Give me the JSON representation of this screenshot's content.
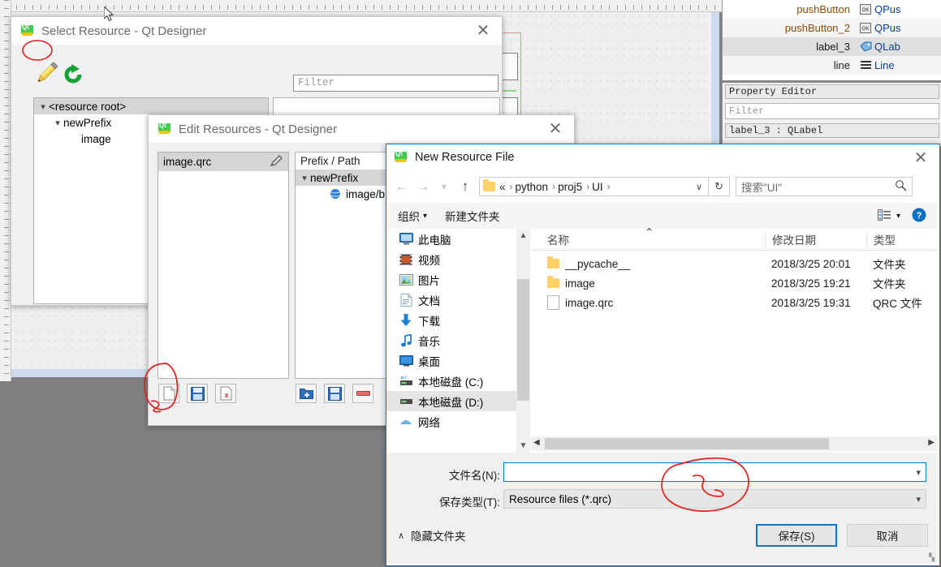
{
  "designer": {
    "object_inspector": {
      "rows": [
        {
          "name": "pushButton",
          "class": "QPus",
          "icon": "ok-button-icon"
        },
        {
          "name": "pushButton_2",
          "class": "QPus",
          "icon": "ok-button-icon"
        },
        {
          "name": "label_3",
          "class": "QLab",
          "icon": "label-tag-icon"
        },
        {
          "name": "line",
          "class": "Line",
          "icon": "line-icon"
        }
      ]
    },
    "property_editor": {
      "title": "Property Editor",
      "filter_placeholder": "Filter",
      "selected_object": "label_3 : QLabel"
    }
  },
  "select_resource": {
    "title": "Select Resource - Qt Designer",
    "close_label": "✕",
    "edit_icon": "pencil-edit-icon",
    "reload_icon": "reload-refresh-icon",
    "filter_placeholder": "Filter",
    "tree": [
      {
        "label": "<resource root>",
        "depth": 0,
        "expanded": true,
        "selected": true
      },
      {
        "label": "newPrefix",
        "depth": 1,
        "expanded": true,
        "selected": false
      },
      {
        "label": "image",
        "depth": 2,
        "expanded": false,
        "selected": false
      }
    ]
  },
  "edit_resources": {
    "title": "Edit Resources - Qt Designer",
    "close_label": "✕",
    "qrc_file": "image.qrc",
    "qrc_edit_icon": "pencil-edit-icon",
    "tree_header": "Prefix / Path",
    "tree": [
      {
        "label": "newPrefix",
        "depth": 0,
        "expanded": true,
        "selected": true
      },
      {
        "label": "image/b",
        "depth": 1,
        "expanded": false,
        "selected": false
      }
    ],
    "left_buttons": [
      {
        "name": "new-resource-file-button",
        "icon": "new-document-icon"
      },
      {
        "name": "open-resource-file-button",
        "icon": "floppy-disk-icon"
      },
      {
        "name": "remove-resource-file-button",
        "icon": "document-delete-icon"
      }
    ],
    "right_buttons": [
      {
        "name": "add-prefix-button",
        "icon": "add-folder-icon"
      },
      {
        "name": "add-file-button",
        "icon": "floppy-disk-icon"
      },
      {
        "name": "remove-item-button",
        "icon": "minus-icon"
      }
    ]
  },
  "new_resource_file": {
    "title": "New Resource File",
    "close_label": "✕",
    "nav": {
      "back_icon": "arrow-left-icon",
      "forward_icon": "arrow-right-icon",
      "recent_icon": "chevron-down-icon",
      "up_icon": "arrow-up-icon"
    },
    "breadcrumb": {
      "prefix": "«",
      "parts": [
        "python",
        "proj5",
        "UI"
      ],
      "separator": "›",
      "chevron": "∨"
    },
    "refresh_icon": "refresh-icon",
    "search_placeholder": "搜索\"UI\"",
    "search_icon": "magnifier-icon",
    "toolbar": {
      "organize": "组织",
      "organize_chevron": "▾",
      "new_folder": "新建文件夹",
      "view_icon": "view-layout-icon",
      "view_chevron": "▾",
      "help_icon": "help-question-icon"
    },
    "sidebar": [
      {
        "label": "此电脑",
        "icon": "computer-icon",
        "selected": false
      },
      {
        "label": "视频",
        "icon": "videos-icon",
        "selected": false
      },
      {
        "label": "图片",
        "icon": "pictures-icon",
        "selected": false
      },
      {
        "label": "文档",
        "icon": "documents-icon",
        "selected": false
      },
      {
        "label": "下载",
        "icon": "downloads-icon",
        "selected": false
      },
      {
        "label": "音乐",
        "icon": "music-icon",
        "selected": false
      },
      {
        "label": "桌面",
        "icon": "desktop-icon",
        "selected": false
      },
      {
        "label": "本地磁盘 (C:)",
        "icon": "drive-icon",
        "selected": false
      },
      {
        "label": "本地磁盘 (D:)",
        "icon": "drive-icon",
        "selected": true
      },
      {
        "label": "网络",
        "icon": "network-icon",
        "selected": false
      }
    ],
    "columns": {
      "name": "名称",
      "date": "修改日期",
      "type": "类型",
      "sort_indicator": "⌃"
    },
    "files": [
      {
        "name": "__pycache__",
        "date": "2018/3/25 20:01",
        "type": "文件夹",
        "icon": "folder-icon"
      },
      {
        "name": "image",
        "date": "2018/3/25 19:21",
        "type": "文件夹",
        "icon": "folder-icon"
      },
      {
        "name": "image.qrc",
        "date": "2018/3/25 19:31",
        "type": "QRC 文件",
        "icon": "file-icon"
      }
    ],
    "footer": {
      "filename_label": "文件名(N):",
      "filename_value": "",
      "filetype_label": "保存类型(T):",
      "filetype_value": "Resource files (*.qrc)",
      "hide_folders_chevron": "∧",
      "hide_folders": "隐藏文件夹",
      "save_button": "保存(S)",
      "cancel_button": "取消"
    }
  },
  "annotations": {
    "color": "#e51c1c",
    "marks": [
      "circle-near-edit-icon",
      "circle-near-new-resource-button",
      "circle-near-filename-field"
    ]
  }
}
